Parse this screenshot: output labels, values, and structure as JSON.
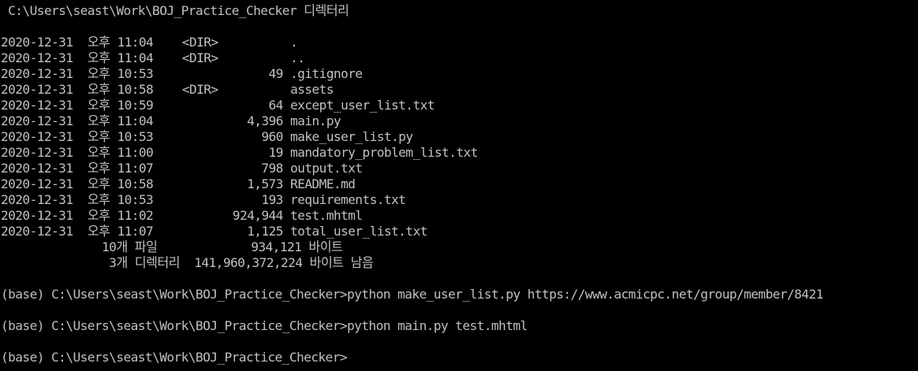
{
  "terminal": {
    "background_color": "#000000",
    "text_color": "#c0c0c0",
    "lines": [
      " C:\\Users\\seast\\Work\\BOJ_Practice_Checker 디렉터리",
      "",
      "2020-12-31  오후 11:04    <DIR>          .",
      "2020-12-31  오후 11:04    <DIR>          ..",
      "2020-12-31  오후 10:53                49 .gitignore",
      "2020-12-31  오후 10:58    <DIR>          assets",
      "2020-12-31  오후 10:59                64 except_user_list.txt",
      "2020-12-31  오후 11:04             4,396 main.py",
      "2020-12-31  오후 10:53               960 make_user_list.py",
      "2020-12-31  오후 11:00                19 mandatory_problem_list.txt",
      "2020-12-31  오후 11:07               798 output.txt",
      "2020-12-31  오후 10:58             1,573 README.md",
      "2020-12-31  오후 10:53               193 requirements.txt",
      "2020-12-31  오후 11:02           924,944 test.mhtml",
      "2020-12-31  오후 11:07             1,125 total_user_list.txt",
      "              10개 파일             934,121 바이트",
      "               3개 디렉터리  141,960,372,224 바이트 남음",
      "",
      "(base) C:\\Users\\seast\\Work\\BOJ_Practice_Checker>python make_user_list.py https://www.acmicpc.net/group/member/8421",
      "",
      "(base) C:\\Users\\seast\\Work\\BOJ_Practice_Checker>python main.py test.mhtml",
      "",
      "(base) C:\\Users\\seast\\Work\\BOJ_Practice_Checker>"
    ]
  }
}
